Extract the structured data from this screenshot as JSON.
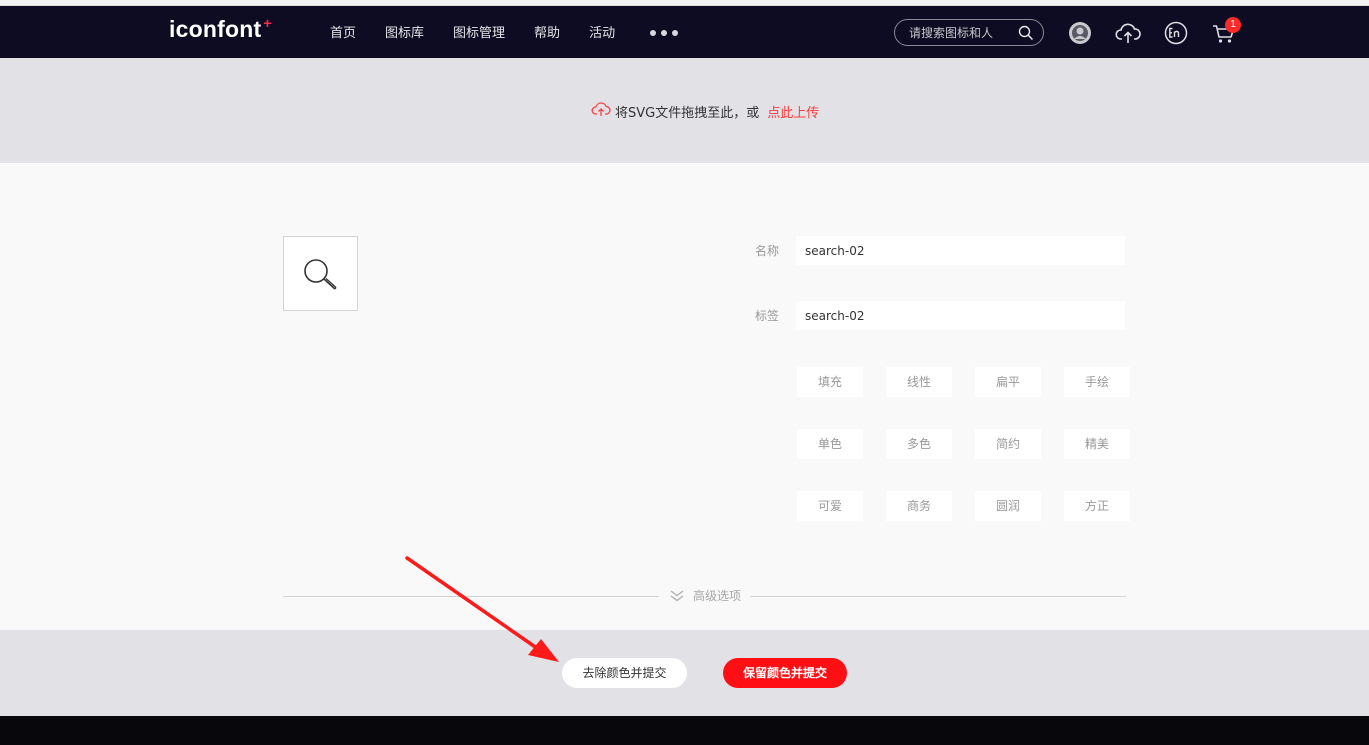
{
  "header": {
    "logo": "iconfont",
    "logo_mark": "+",
    "nav": [
      "首页",
      "图标库",
      "图标管理",
      "帮助",
      "活动"
    ],
    "search_placeholder": "请搜索图标和人",
    "cart_count": "1",
    "icons": [
      "user-avatar-icon",
      "upload-cloud-icon",
      "language-en-icon",
      "cart-icon"
    ]
  },
  "upload": {
    "text": "将SVG文件拖拽至此，或",
    "link": "点此上传"
  },
  "form": {
    "name_label": "名称",
    "name_value": "search-02",
    "tag_label": "标签",
    "tag_value": "search-02",
    "style_tags": [
      [
        "填充",
        "线性",
        "扁平",
        "手绘"
      ],
      [
        "单色",
        "多色",
        "简约",
        "精美"
      ],
      [
        "可爱",
        "商务",
        "圆润",
        "方正"
      ]
    ],
    "advanced": "高级选项"
  },
  "actions": {
    "remove_color_submit": "去除颜色并提交",
    "keep_color_submit": "保留颜色并提交"
  },
  "colors": {
    "header_bg": "#0d0c22",
    "accent_red": "#ff0f14",
    "annotation_arrow": "#ff1a1a"
  }
}
